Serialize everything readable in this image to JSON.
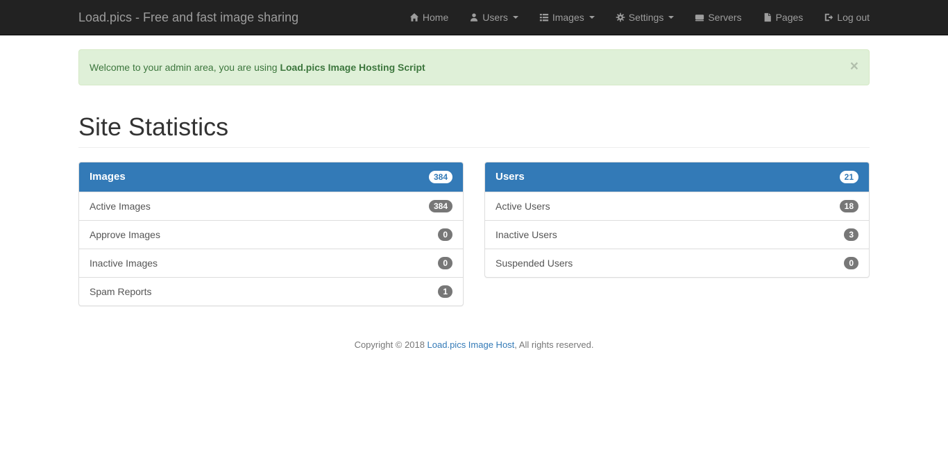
{
  "navbar": {
    "brand": "Load.pics - Free and fast image sharing",
    "items": [
      {
        "label": "Home",
        "icon": "home-icon",
        "dropdown": false
      },
      {
        "label": "Users",
        "icon": "user-icon",
        "dropdown": true
      },
      {
        "label": "Images",
        "icon": "list-icon",
        "dropdown": true
      },
      {
        "label": "Settings",
        "icon": "gear-icon",
        "dropdown": true
      },
      {
        "label": "Servers",
        "icon": "server-icon",
        "dropdown": false
      },
      {
        "label": "Pages",
        "icon": "file-icon",
        "dropdown": false
      },
      {
        "label": "Log out",
        "icon": "logout-icon",
        "dropdown": false
      }
    ]
  },
  "alert": {
    "text_prefix": "Welcome to your admin area, you are using ",
    "text_bold": "Load.pics Image Hosting Script",
    "close_label": "×"
  },
  "page": {
    "title": "Site Statistics"
  },
  "panels": [
    {
      "title": "Images",
      "badge": "384",
      "rows": [
        {
          "label": "Active Images",
          "badge": "384"
        },
        {
          "label": "Approve Images",
          "badge": "0"
        },
        {
          "label": "Inactive Images",
          "badge": "0"
        },
        {
          "label": "Spam Reports",
          "badge": "1"
        }
      ]
    },
    {
      "title": "Users",
      "badge": "21",
      "rows": [
        {
          "label": "Active Users",
          "badge": "18"
        },
        {
          "label": "Inactive Users",
          "badge": "3"
        },
        {
          "label": "Suspended Users",
          "badge": "0"
        }
      ]
    }
  ],
  "footer": {
    "prefix": "Copyright © 2018 ",
    "link": "Load.pics Image Host",
    "suffix": ", All rights reserved."
  },
  "colors": {
    "navbar_bg": "#222222",
    "navbar_text": "#9d9d9d",
    "accent": "#337ab7",
    "alert_bg": "#dff0d8",
    "alert_border": "#d6e9c6",
    "alert_text": "#3c763d",
    "badge_bg": "#777777",
    "panel_border": "#dddddd"
  }
}
